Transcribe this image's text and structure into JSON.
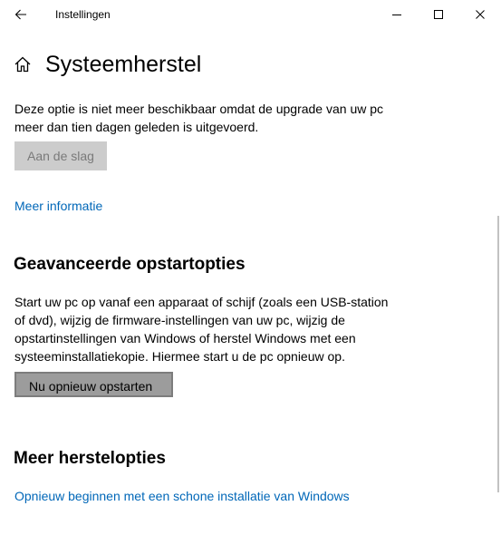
{
  "window": {
    "app_title": "Instellingen"
  },
  "header": {
    "title": "Systeemherstel"
  },
  "reset_section": {
    "description_line1": "Deze optie is niet meer beschikbaar omdat de upgrade van uw pc",
    "description_line2": "meer dan tien dagen geleden is uitgevoerd.",
    "button_label": "Aan de slag",
    "more_info_link": "Meer informatie"
  },
  "advanced_startup": {
    "title": "Geavanceerde opstartopties",
    "description_line1": "Start uw pc op vanaf een apparaat of schijf (zoals een USB-station",
    "description_line2": "of dvd), wijzig de firmware-instellingen van uw pc, wijzig de",
    "description_line3": "opstartinstellingen van Windows of herstel Windows met een",
    "description_line4": "systeeminstallatiekopie. Hiermee start u de pc opnieuw op.",
    "button_label": "Nu opnieuw opstarten"
  },
  "more_options": {
    "title": "Meer herstelopties",
    "link": "Opnieuw beginnen met een schone installatie van Windows"
  },
  "icons": {
    "back": "back-arrow-icon",
    "home": "home-icon",
    "minimize": "minimize-icon",
    "maximize": "maximize-icon",
    "close": "close-icon"
  },
  "colors": {
    "link": "#0067b8",
    "disabled_button_bg": "#cccccc",
    "primary_button_bg": "#9c9c9c"
  }
}
